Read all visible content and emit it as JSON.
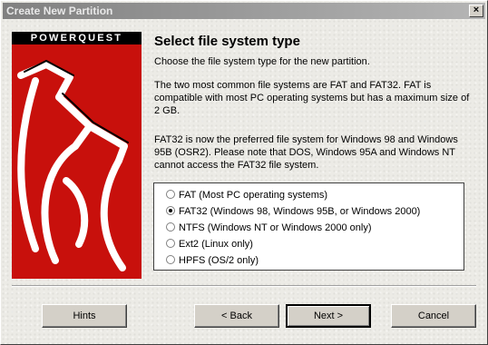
{
  "window": {
    "title": "Create New Partition",
    "close_glyph": "×"
  },
  "logo": {
    "brand": "POWERQUEST"
  },
  "heading": "Select file system type",
  "paragraphs": [
    "Choose the file system type for the new partition.",
    "The two most common file systems are FAT and FAT32.  FAT is compatible with most PC operating systems but has a maximum size of 2 GB.",
    "FAT32 is now the preferred file system for Windows 98 and Windows 95B (OSR2).  Please note that DOS, Windows 95A and Windows NT cannot access the FAT32 file system."
  ],
  "options": [
    {
      "label": "FAT (Most PC operating systems)",
      "selected": false
    },
    {
      "label": "FAT32 (Windows 98, Windows 95B, or Windows 2000)",
      "selected": true
    },
    {
      "label": "NTFS (Windows NT or Windows 2000 only)",
      "selected": false
    },
    {
      "label": "Ext2 (Linux only)",
      "selected": false
    },
    {
      "label": "HPFS (OS/2 only)",
      "selected": false
    }
  ],
  "buttons": {
    "hints": "Hints",
    "back": "< Back",
    "next": "Next >",
    "cancel": "Cancel"
  },
  "colors": {
    "logo_red": "#c8100c",
    "titlebar_inactive": "#808080"
  }
}
